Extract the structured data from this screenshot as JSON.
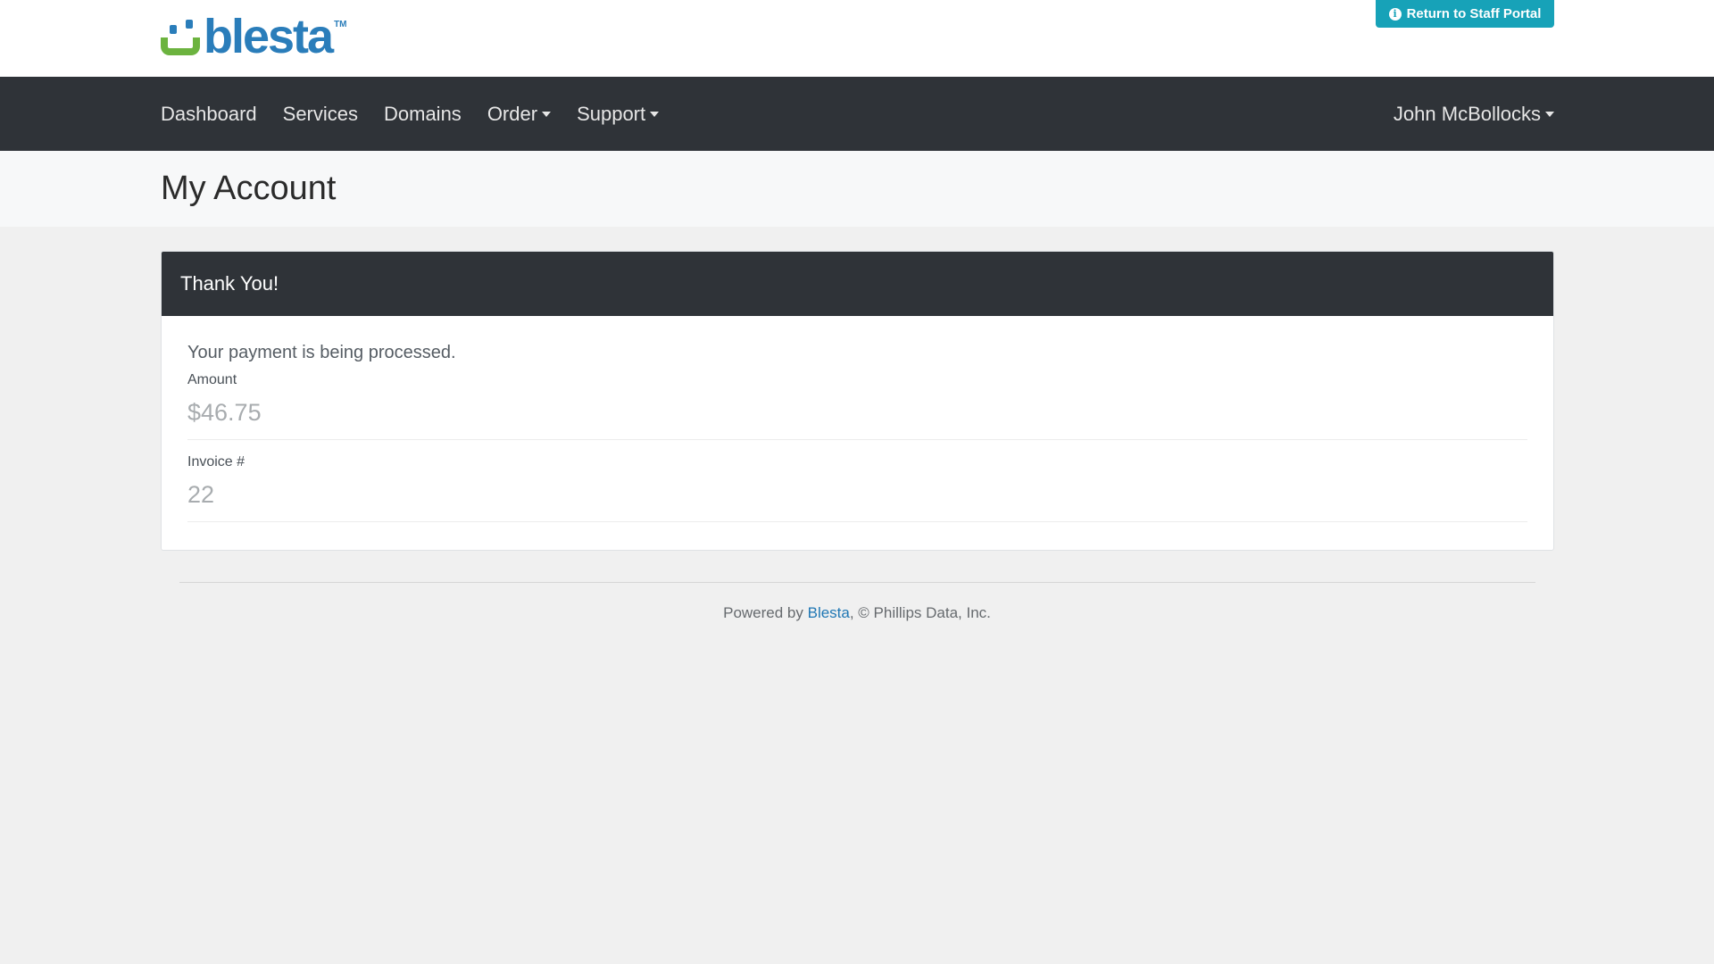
{
  "header": {
    "logo_text": "blesta",
    "logo_tm": "TM",
    "staff_portal_button": "Return to Staff Portal",
    "staff_portal_icon": "info-circle-icon"
  },
  "nav": {
    "items": [
      {
        "label": "Dashboard"
      },
      {
        "label": "Services"
      },
      {
        "label": "Domains"
      },
      {
        "label": "Order"
      },
      {
        "label": "Support"
      }
    ],
    "user": "John McBollocks"
  },
  "page": {
    "title": "My Account"
  },
  "card": {
    "header": "Thank You!",
    "message": "Your payment is being processed.",
    "fields": [
      {
        "label": "Amount",
        "value": "$46.75"
      },
      {
        "label": "Invoice #",
        "value": "22"
      }
    ]
  },
  "footer": {
    "prefix": "Powered by ",
    "link": "Blesta",
    "suffix": ", © Phillips Data, Inc."
  },
  "colors": {
    "accent": "#17a2b8",
    "navbar": "#2f3338",
    "logo_blue": "#2a7dba",
    "logo_green": "#6cb33f",
    "link": "#1f77b4"
  }
}
